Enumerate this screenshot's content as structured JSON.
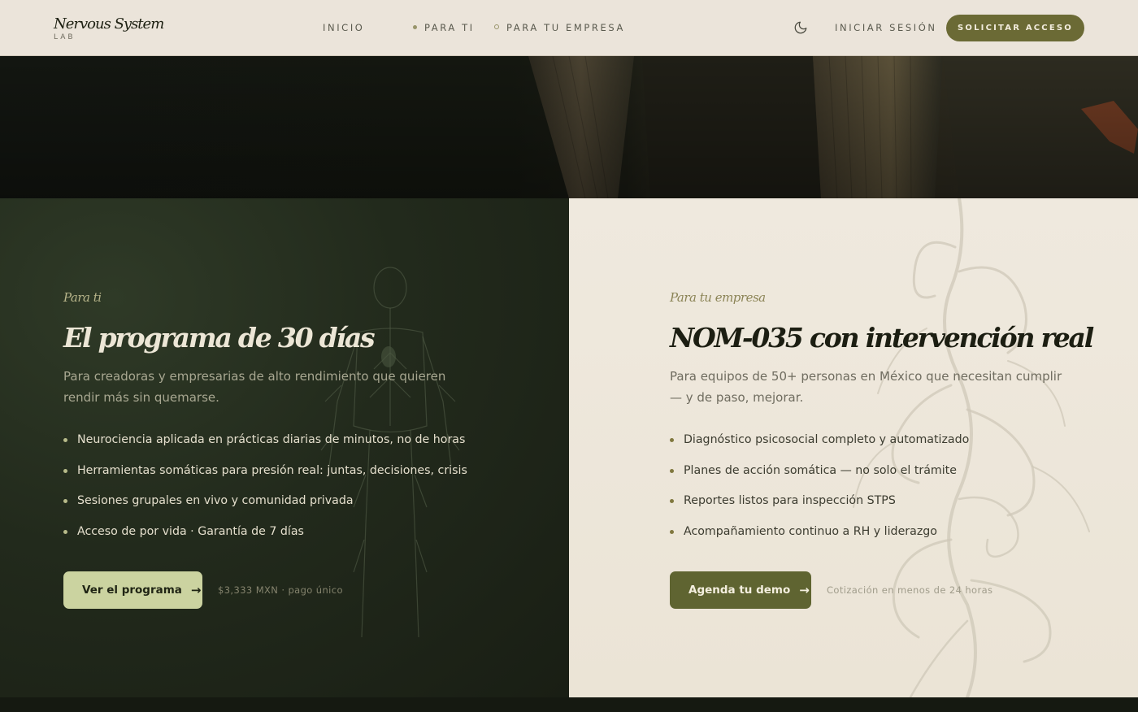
{
  "nav": {
    "brand_name": "Nervous System",
    "brand_sub": "LAB",
    "links": [
      {
        "label": "INICIO"
      },
      {
        "label": "PARA TI"
      },
      {
        "label": "PARA TU EMPRESA"
      }
    ],
    "theme_icon": "moon-icon",
    "login_label": "INICIAR SESIÓN",
    "cta_label": "SOLICITAR ACCESO"
  },
  "left_panel": {
    "eyebrow": "Para ti",
    "title": "El programa de 30 días",
    "description": "Para creadoras y empresarias de alto rendimiento que quieren rendir más sin quemarse.",
    "bullets": [
      "Neurociencia aplicada en prácticas diarias de minutos, no de horas",
      "Herramientas somáticas para presión real: juntas, decisiones, crisis",
      "Sesiones grupales en vivo y comunidad privada",
      "Acceso de por vida · Garantía de 7 días"
    ],
    "button_label": "Ver el programa",
    "note": "$3,333 MXN · pago único"
  },
  "right_panel": {
    "eyebrow": "Para tu empresa",
    "title": "NOM-035 con intervención real",
    "description": "Para equipos de 50+ personas en México que necesitan cumplir — y de paso, mejorar.",
    "bullets": [
      "Diagnóstico psicosocial completo y automatizado",
      "Planes de acción somática — no solo el trámite",
      "Reportes listos para inspección STPS",
      "Acompañamiento continuo a RH y liderazgo"
    ],
    "button_label": "Agenda tu demo",
    "note": "Cotización en menos de 24 horas"
  },
  "colors": {
    "accent_olive": "#6b6a35",
    "left_button": "#cbd3a0",
    "right_button": "#5f6431",
    "nav_bg": "#ebe4da"
  }
}
